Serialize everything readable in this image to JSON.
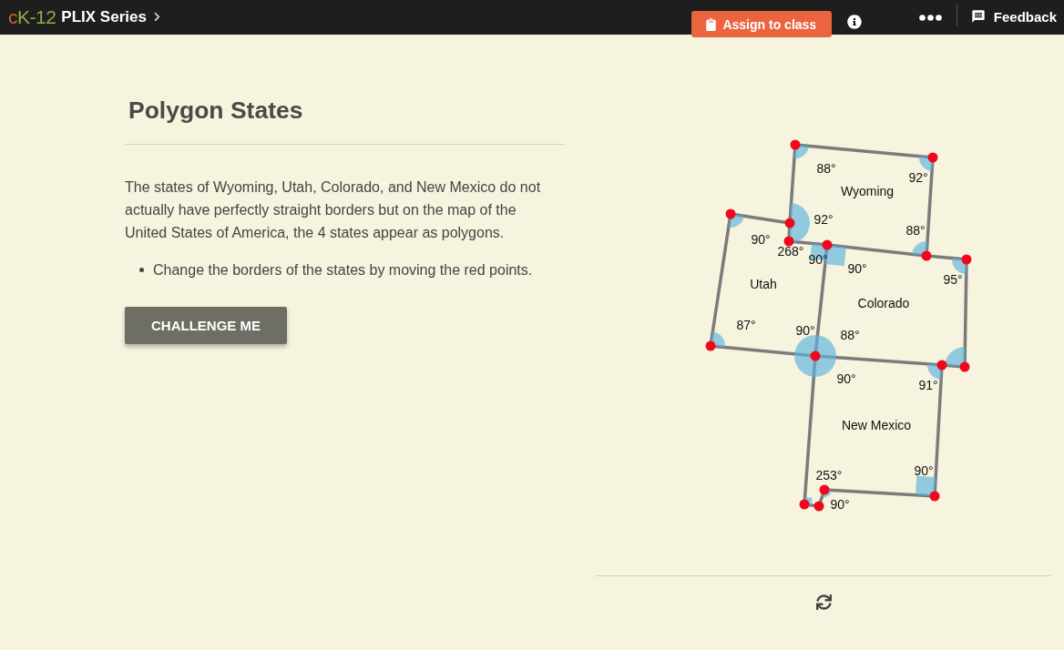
{
  "header": {
    "logo": [
      {
        "text": "c",
        "color": "#d4622a"
      },
      {
        "text": "K-12",
        "color": "#8bb04c"
      }
    ],
    "breadcrumb": "PLIX Series",
    "assign_button": "Assign to class",
    "feedback_button": "Feedback"
  },
  "lesson": {
    "title": "Polygon States",
    "paragraph": "The states of Wyoming, Utah, Colorado, and New Mexico do not actually have perfectly straight borders but on the map of the United States of America, the 4 states appear as polygons.",
    "bullets": [
      "Change the borders of the states by moving the red points."
    ],
    "challenge_button": "CHALLENGE ME"
  },
  "diagram": {
    "state_labels": [
      "Wyoming",
      "Utah",
      "Colorado",
      "New Mexico"
    ],
    "angle_labels": [
      "88°",
      "92°",
      "92°",
      "88°",
      "90°",
      "268°",
      "90°",
      "90°",
      "95°",
      "87°",
      "90°",
      "88°",
      "90°",
      "91°",
      "90°",
      "253°",
      "90°"
    ]
  }
}
